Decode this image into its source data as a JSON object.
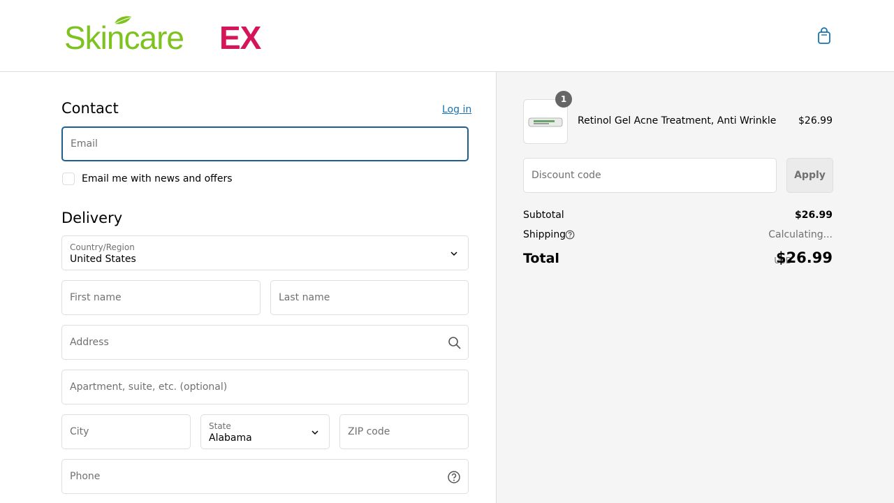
{
  "header": {
    "logo_text_main": "Skincare",
    "logo_text_accent": "EX",
    "logo_colors": {
      "main": "#7dc21e",
      "accent": "#d5145a",
      "leaf": "#7dc21e"
    },
    "cart_icon": "shopping-bag-icon"
  },
  "contact": {
    "title": "Contact",
    "login_label": "Log in",
    "email_placeholder": "Email",
    "newsletter_label": "Email me with news and offers"
  },
  "delivery": {
    "title": "Delivery",
    "country_label": "Country/Region",
    "country_value": "United States",
    "first_name_placeholder": "First name",
    "last_name_placeholder": "Last name",
    "address_placeholder": "Address",
    "apartment_placeholder": "Apartment, suite, etc. (optional)",
    "city_placeholder": "City",
    "state_label": "State",
    "state_value": "Alabama",
    "zip_placeholder": "ZIP code",
    "phone_placeholder": "Phone"
  },
  "summary": {
    "item": {
      "quantity": "1",
      "name": "Retinol Gel Acne Treatment, Anti Wrinkle",
      "price": "$26.99"
    },
    "discount_placeholder": "Discount code",
    "apply_label": "Apply",
    "subtotal_label": "Subtotal",
    "subtotal_value": "$26.99",
    "shipping_label": "Shipping",
    "shipping_value": "Calculating...",
    "total_label": "Total",
    "currency": "USD",
    "total_value": "$26.99"
  },
  "colors": {
    "link": "#1773b0",
    "focus_border": "#1f5f8f",
    "summary_bg": "#f5f5f5"
  }
}
